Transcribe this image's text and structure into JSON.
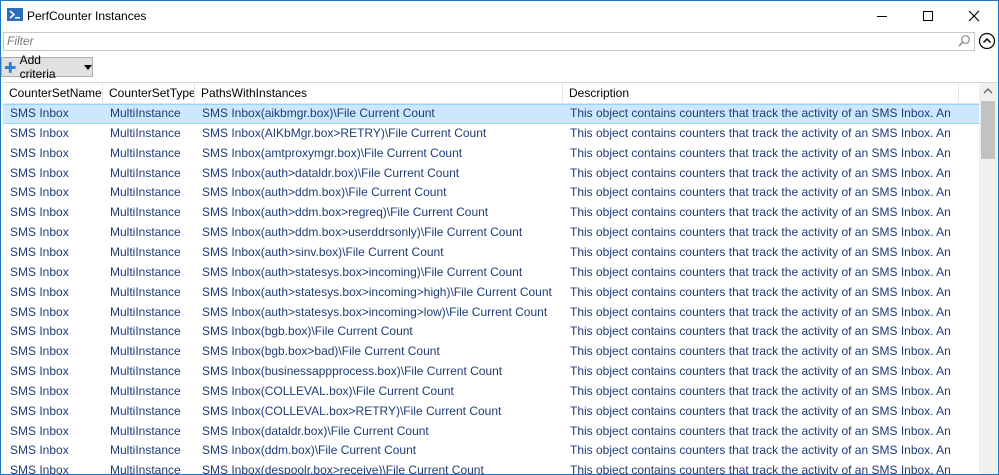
{
  "window": {
    "title": "PerfCounter Instances"
  },
  "filter": {
    "placeholder": "Filter"
  },
  "toolbar": {
    "add_criteria_label": "Add criteria"
  },
  "columns": [
    "CounterSetName",
    "CounterSetType",
    "PathsWithInstances",
    "Description"
  ],
  "rows": [
    [
      "SMS Inbox",
      "MultiInstance",
      "SMS Inbox(aikbmgr.box)\\File Current Count",
      "This object contains counters that track the activity of an SMS Inbox.  An S..."
    ],
    [
      "SMS Inbox",
      "MultiInstance",
      "SMS Inbox(AIKbMgr.box>RETRY)\\File Current Count",
      "This object contains counters that track the activity of an SMS Inbox.  An S..."
    ],
    [
      "SMS Inbox",
      "MultiInstance",
      "SMS Inbox(amtproxymgr.box)\\File Current Count",
      "This object contains counters that track the activity of an SMS Inbox.  An S..."
    ],
    [
      "SMS Inbox",
      "MultiInstance",
      "SMS Inbox(auth>dataldr.box)\\File Current Count",
      "This object contains counters that track the activity of an SMS Inbox.  An S..."
    ],
    [
      "SMS Inbox",
      "MultiInstance",
      "SMS Inbox(auth>ddm.box)\\File Current Count",
      "This object contains counters that track the activity of an SMS Inbox.  An S..."
    ],
    [
      "SMS Inbox",
      "MultiInstance",
      "SMS Inbox(auth>ddm.box>regreq)\\File Current Count",
      "This object contains counters that track the activity of an SMS Inbox.  An S..."
    ],
    [
      "SMS Inbox",
      "MultiInstance",
      "SMS Inbox(auth>ddm.box>userddrsonly)\\File Current Count",
      "This object contains counters that track the activity of an SMS Inbox.  An S..."
    ],
    [
      "SMS Inbox",
      "MultiInstance",
      "SMS Inbox(auth>sinv.box)\\File Current Count",
      "This object contains counters that track the activity of an SMS Inbox.  An S..."
    ],
    [
      "SMS Inbox",
      "MultiInstance",
      "SMS Inbox(auth>statesys.box>incoming)\\File Current Count",
      "This object contains counters that track the activity of an SMS Inbox.  An S..."
    ],
    [
      "SMS Inbox",
      "MultiInstance",
      "SMS Inbox(auth>statesys.box>incoming>high)\\File Current Count",
      "This object contains counters that track the activity of an SMS Inbox.  An S..."
    ],
    [
      "SMS Inbox",
      "MultiInstance",
      "SMS Inbox(auth>statesys.box>incoming>low)\\File Current Count",
      "This object contains counters that track the activity of an SMS Inbox.  An S..."
    ],
    [
      "SMS Inbox",
      "MultiInstance",
      "SMS Inbox(bgb.box)\\File Current Count",
      "This object contains counters that track the activity of an SMS Inbox.  An S..."
    ],
    [
      "SMS Inbox",
      "MultiInstance",
      "SMS Inbox(bgb.box>bad)\\File Current Count",
      "This object contains counters that track the activity of an SMS Inbox.  An S..."
    ],
    [
      "SMS Inbox",
      "MultiInstance",
      "SMS Inbox(businessappprocess.box)\\File Current Count",
      "This object contains counters that track the activity of an SMS Inbox.  An S..."
    ],
    [
      "SMS Inbox",
      "MultiInstance",
      "SMS Inbox(COLLEVAL.box)\\File Current Count",
      "This object contains counters that track the activity of an SMS Inbox.  An S..."
    ],
    [
      "SMS Inbox",
      "MultiInstance",
      "SMS Inbox(COLLEVAL.box>RETRY)\\File Current Count",
      "This object contains counters that track the activity of an SMS Inbox.  An S..."
    ],
    [
      "SMS Inbox",
      "MultiInstance",
      "SMS Inbox(dataldr.box)\\File Current Count",
      "This object contains counters that track the activity of an SMS Inbox.  An S..."
    ],
    [
      "SMS Inbox",
      "MultiInstance",
      "SMS Inbox(ddm.box)\\File Current Count",
      "This object contains counters that track the activity of an SMS Inbox.  An S..."
    ],
    [
      "SMS Inbox",
      "MultiInstance",
      "SMS Inbox(despoolr.box>receive)\\File Current Count",
      "This object contains counters that track the activity of an SMS Inbox.  An S..."
    ]
  ],
  "selected_row_index": 0,
  "colors": {
    "accent_border": "#1a78c8",
    "selected_row": "#cce8ff",
    "cell_text": "#1e3c78"
  },
  "icons": [
    "powershell-icon",
    "minimize-icon",
    "maximize-icon",
    "close-icon",
    "search-icon",
    "collapse-up-icon",
    "plus-icon",
    "chevron-down-icon",
    "scroll-up-icon"
  ]
}
